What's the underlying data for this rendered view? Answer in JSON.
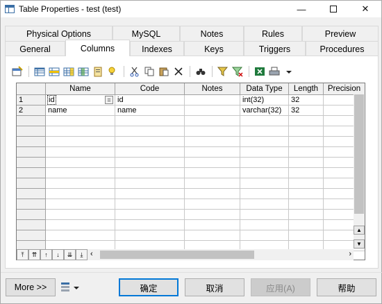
{
  "window": {
    "title": "Table Properties - test (test)",
    "minimize": "—",
    "maximize": "☐",
    "close": "✕"
  },
  "tabs": {
    "row1": [
      "Physical Options",
      "MySQL",
      "Notes",
      "Rules",
      "Preview"
    ],
    "row2": [
      "General",
      "Columns",
      "Indexes",
      "Keys",
      "Triggers",
      "Procedures"
    ],
    "active": "Columns"
  },
  "toolbar": {
    "icons": [
      "properties-icon",
      "add-row-icon",
      "insert-row-icon",
      "add-column-icon",
      "insert-column-icon",
      "paste-column-icon",
      "lightbulb-icon",
      "cut-icon",
      "copy-icon",
      "paste-icon",
      "delete-icon",
      "find-icon",
      "filter-icon",
      "clear-filter-icon",
      "excel-export-icon",
      "print-icon",
      "dropdown-arrow-icon"
    ]
  },
  "grid": {
    "columns": [
      "Name",
      "Code",
      "Notes",
      "Data Type",
      "Length",
      "Precision"
    ],
    "rows": [
      {
        "num": "1",
        "name": "id",
        "code": "id",
        "notes": "",
        "datatype": "int(32)",
        "length": "32",
        "precision": ""
      },
      {
        "num": "2",
        "name": "name",
        "code": "name",
        "notes": "",
        "datatype": "varchar(32)",
        "length": "32",
        "precision": ""
      }
    ],
    "equals_button": "="
  },
  "nav_buttons": [
    "top",
    "page-up",
    "up",
    "down",
    "page-down",
    "bottom"
  ],
  "buttons": {
    "more": "More >>",
    "ok": "确定",
    "cancel": "取消",
    "apply": "应用(A)",
    "help": "帮助"
  },
  "colors": {
    "accent": "#0078d7",
    "selection": "#3399ff"
  }
}
